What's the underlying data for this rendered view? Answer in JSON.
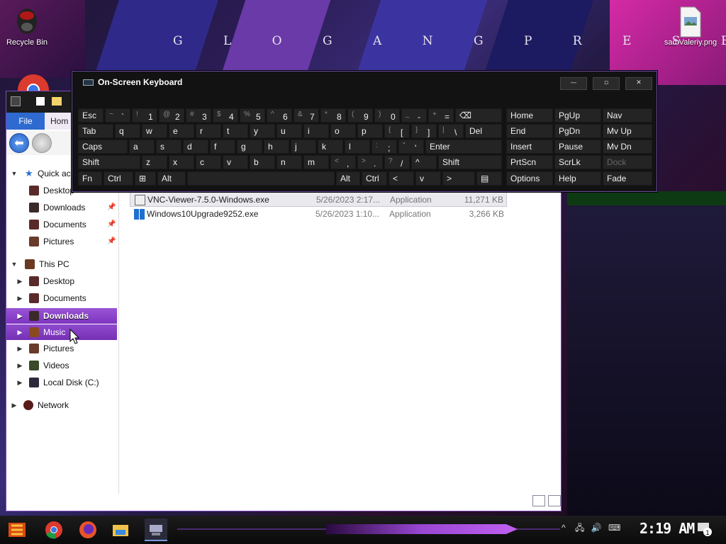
{
  "wallpaper": {
    "title_text": "G L O G A N G   P R E S E N T S"
  },
  "desktop": {
    "icons": [
      {
        "label": "Recycle Bin",
        "icon": "recycle-bin-icon"
      },
      {
        "label": "sad Valeriy.png",
        "icon": "image-file-icon"
      }
    ]
  },
  "explorer": {
    "ribbon": {
      "file_tab": "File",
      "home_tab": "Hom"
    },
    "nav": {
      "quick_access": "Quick ac",
      "quick_items": [
        "Desktop",
        "Downloads",
        "Documents",
        "Pictures"
      ],
      "this_pc": "This PC",
      "pc_items": [
        "Desktop",
        "Documents",
        "Downloads",
        "Music",
        "Pictures",
        "Videos",
        "Local Disk (C:)"
      ],
      "network": "Network"
    },
    "files": [
      {
        "name": "VNC-Viewer-7.5.0-Windows.exe",
        "date": "5/26/2023 2:17...",
        "type": "Application",
        "size": "11,271 KB"
      },
      {
        "name": "Windows10Upgrade9252.exe",
        "date": "5/26/2023 1:10...",
        "type": "Application",
        "size": "3,266 KB"
      }
    ]
  },
  "osk": {
    "title": "On-Screen Keyboard",
    "row1": [
      {
        "main": "Esc"
      },
      {
        "shift": "~",
        "main": "`"
      },
      {
        "shift": "!",
        "main": "1"
      },
      {
        "shift": "@",
        "main": "2"
      },
      {
        "shift": "#",
        "main": "3"
      },
      {
        "shift": "$",
        "main": "4"
      },
      {
        "shift": "%",
        "main": "5"
      },
      {
        "shift": "^",
        "main": "6"
      },
      {
        "shift": "&",
        "main": "7"
      },
      {
        "shift": "*",
        "main": "8"
      },
      {
        "shift": "(",
        "main": "9"
      },
      {
        "shift": ")",
        "main": "0"
      },
      {
        "shift": "_",
        "main": "-"
      },
      {
        "shift": "+",
        "main": "="
      },
      {
        "main": "⌫"
      }
    ],
    "row2": [
      {
        "main": "Tab"
      },
      {
        "main": "q"
      },
      {
        "main": "w"
      },
      {
        "main": "e"
      },
      {
        "main": "r"
      },
      {
        "main": "t"
      },
      {
        "main": "y"
      },
      {
        "main": "u"
      },
      {
        "main": "i"
      },
      {
        "main": "o"
      },
      {
        "main": "p"
      },
      {
        "shift": "{",
        "main": "["
      },
      {
        "shift": "}",
        "main": "]"
      },
      {
        "shift": "|",
        "main": "\\"
      },
      {
        "main": "Del"
      }
    ],
    "row3": [
      {
        "main": "Caps"
      },
      {
        "main": "a"
      },
      {
        "main": "s"
      },
      {
        "main": "d"
      },
      {
        "main": "f"
      },
      {
        "main": "g"
      },
      {
        "main": "h"
      },
      {
        "main": "j"
      },
      {
        "main": "k"
      },
      {
        "main": "l"
      },
      {
        "shift": ":",
        "main": ";"
      },
      {
        "shift": "\"",
        "main": "'"
      },
      {
        "main": "Enter"
      }
    ],
    "row4": [
      {
        "main": "Shift"
      },
      {
        "main": "z"
      },
      {
        "main": "x"
      },
      {
        "main": "c"
      },
      {
        "main": "v"
      },
      {
        "main": "b"
      },
      {
        "main": "n"
      },
      {
        "main": "m"
      },
      {
        "shift": "<",
        "main": ","
      },
      {
        "shift": ">",
        "main": "."
      },
      {
        "shift": "?",
        "main": "/"
      },
      {
        "main": "^"
      },
      {
        "main": "Shift"
      }
    ],
    "row5": [
      {
        "main": "Fn"
      },
      {
        "main": "Ctrl"
      },
      {
        "main": "⊞"
      },
      {
        "main": "Alt"
      },
      {
        "main": ""
      },
      {
        "main": "Alt"
      },
      {
        "main": "Ctrl"
      },
      {
        "main": "<"
      },
      {
        "main": "v"
      },
      {
        "main": ">"
      },
      {
        "main": "▤"
      }
    ],
    "nav_keys": [
      [
        "Home",
        "PgUp",
        "Nav"
      ],
      [
        "End",
        "PgDn",
        "Mv Up"
      ],
      [
        "Insert",
        "Pause",
        "Mv Dn"
      ],
      [
        "PrtScn",
        "ScrLk",
        "Dock"
      ],
      [
        "Options",
        "Help",
        "Fade"
      ]
    ]
  },
  "taskbar": {
    "clock": "2:19 AM",
    "notification_count": "1"
  }
}
